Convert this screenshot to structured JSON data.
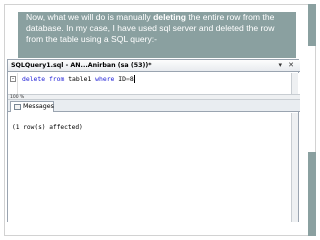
{
  "caption": {
    "before": "Now, what we will do is manually ",
    "bold": "deleting",
    "after": " the entire row from the database. In my case, I have used sql server and deleted the row from the table using a SQL query:-"
  },
  "editor": {
    "tab_title": "SQLQuery1.sql - AN...Anirban (sa (53))*",
    "code": {
      "kw1": "delete",
      "kw2": "from",
      "table": "table1",
      "kw3": "where",
      "column": "ID",
      "op": "=",
      "value": "8"
    },
    "zoom": "100 %"
  },
  "results": {
    "tab_label": "Messages",
    "message": "(1 row(s) affected)"
  },
  "colors": {
    "accent": "#8aa0a0",
    "keyword": "#1c1cd6"
  }
}
